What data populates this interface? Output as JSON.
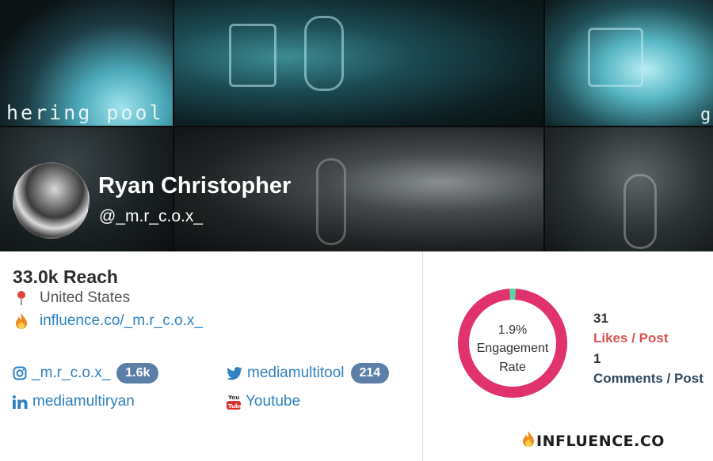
{
  "banner": {
    "captions": [
      "hering pool",
      "g"
    ]
  },
  "profile": {
    "name": "Ryan Christopher",
    "handle": "@_m.r_c.o.x_"
  },
  "stats": {
    "reach": "33.0k Reach",
    "location": "United States",
    "profile_link": "influence.co/_m.r_c.o.x_"
  },
  "socials": {
    "instagram": {
      "handle": "_m.r_c.o.x_",
      "count": "1.6k",
      "icon": "instagram-icon"
    },
    "twitter": {
      "handle": "mediamultitool",
      "count": "214",
      "icon": "twitter-icon"
    },
    "linkedin": {
      "handle": "mediamultiryan",
      "icon": "linkedin-icon"
    },
    "youtube": {
      "handle": "Youtube",
      "icon": "youtube-icon"
    }
  },
  "engagement": {
    "rate": "1.9%",
    "rate_fraction": 0.019,
    "label_line1": "Engagement",
    "label_line2": "Rate",
    "likes_count": "31",
    "likes_label": "Likes / Post",
    "comments_count": "1",
    "comments_label": "Comments / Post"
  },
  "brand": {
    "text": "INFLUENCE.CO"
  },
  "colors": {
    "ring": "#e0326e",
    "ring_highlight": "#5fd3a0",
    "badge": "#5b7fa6",
    "link": "#2f80c1",
    "likes": "#d9534f",
    "comments": "#2d4860"
  }
}
